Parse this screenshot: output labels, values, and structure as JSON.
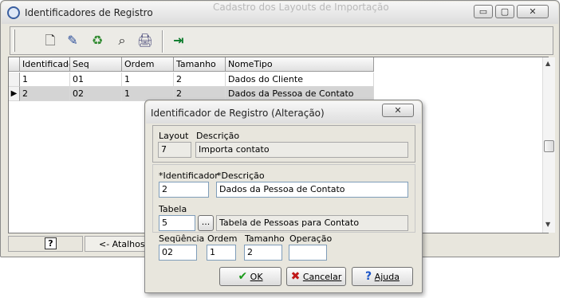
{
  "main_window": {
    "title": "Identificadores de Registro",
    "ghost_title": "Cadastro dos Layouts de Importação",
    "caption_buttons": {
      "minimize": "▭",
      "maximize": "▢",
      "close": "✕"
    },
    "toolbar": {
      "new_icon": "🗋",
      "edit_icon": "✎",
      "delete_icon": "♻",
      "find_icon": "⌕",
      "print_icon": "🖨",
      "exit_icon": "⇥"
    },
    "grid": {
      "columns": [
        "Identificador",
        "Seq",
        "Ordem",
        "Tamanho",
        "NomeTipo"
      ],
      "rows": [
        {
          "indicator": "",
          "cells": [
            "1",
            "01",
            "1",
            "2",
            "Dados do Cliente"
          ]
        },
        {
          "indicator": "▶",
          "cells": [
            "2",
            "02",
            "1",
            "2",
            "Dados da Pessoa de Contato"
          ]
        }
      ]
    },
    "statusbar": {
      "help_icon": "?",
      "shortcut_label": "<- Atalhos"
    }
  },
  "dialog": {
    "title": "Identificador de Registro (Alteração)",
    "close_icon": "✕",
    "layout_label": "Layout",
    "layout_value": "7",
    "layout_desc_label": "Descrição",
    "layout_desc_value": "Importa contato",
    "identificador_label": "*Identificador",
    "identificador_value": "2",
    "descricao_label": "*Descrição",
    "descricao_value": "Dados da Pessoa de Contato",
    "tabela_label": "Tabela",
    "tabela_value": "5",
    "tabela_lookup_label": "...",
    "tabela_desc_value": "Tabela de Pessoas para Contato",
    "sequencia_label": "Seqüência",
    "sequencia_value": "02",
    "ordem_label": "Ordem",
    "ordem_value": "1",
    "tamanho_label": "Tamanho",
    "tamanho_value": "2",
    "operacao_label": "Operação",
    "operacao_value": "",
    "ok_label": "OK",
    "cancel_label": "Cancelar",
    "help_label": "Ajuda",
    "colors": {
      "ok_check": "#1a9a1a",
      "cancel_x": "#c01818",
      "help_q": "#1c55c8"
    }
  }
}
